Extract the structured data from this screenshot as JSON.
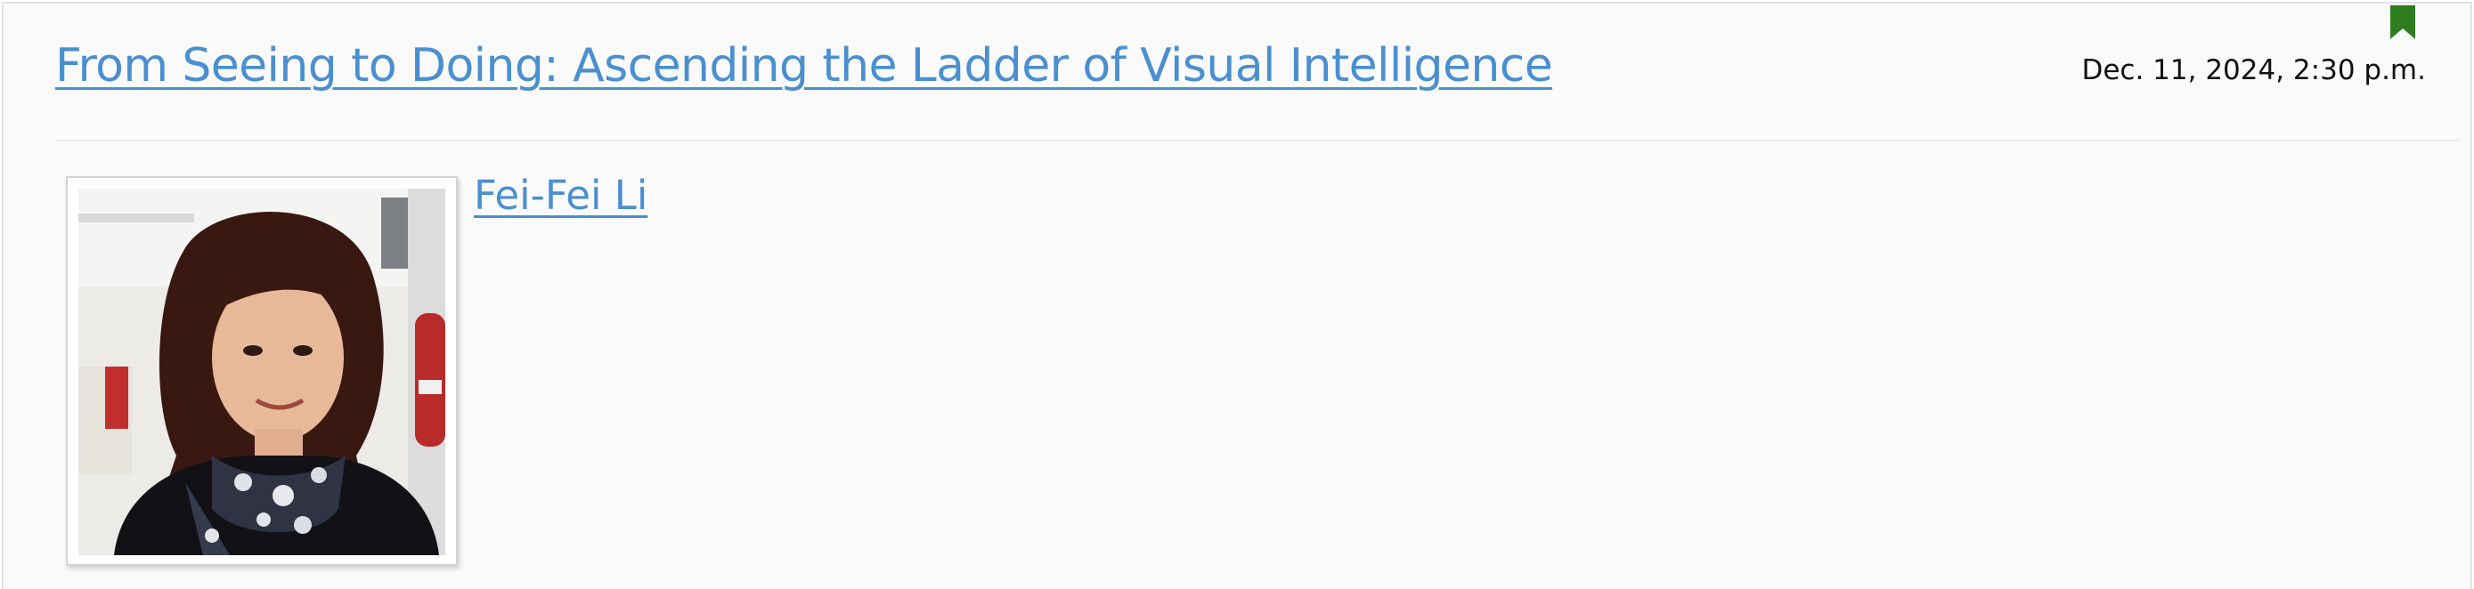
{
  "talk": {
    "title": "From Seeing to Doing: Ascending the Ladder of Visual Intelligence",
    "date": "Dec. 11, 2024, 2:30 p.m.",
    "author": {
      "name": "Fei-Fei Li",
      "photo": "speaker-portrait"
    }
  },
  "icons": {
    "bookmark": "bookmark-icon"
  },
  "colors": {
    "link": "#4a8fd0",
    "bookmark": "#2e7d1f",
    "background": "#fafafa",
    "text": "#111111"
  }
}
